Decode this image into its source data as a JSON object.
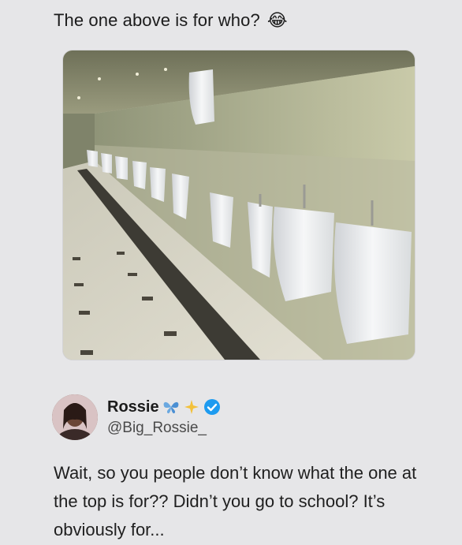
{
  "caption": {
    "text": "The one above is for who?",
    "emoji_icon": "face-with-tears-of-joy-icon"
  },
  "photo": {
    "icon": "restroom-urinals-photo"
  },
  "author": {
    "display_name": "Rossie",
    "handle": "@Big_Rossie_",
    "name_icons": [
      "butterfly-icon",
      "sparkles-icon",
      "verified-badge-icon"
    ],
    "verified_color": "#1d9bf0"
  },
  "tweet": {
    "text": "Wait, so you people don’t know what the one at the top is for?? Didn’t you go to school? It’s obviously for..."
  }
}
